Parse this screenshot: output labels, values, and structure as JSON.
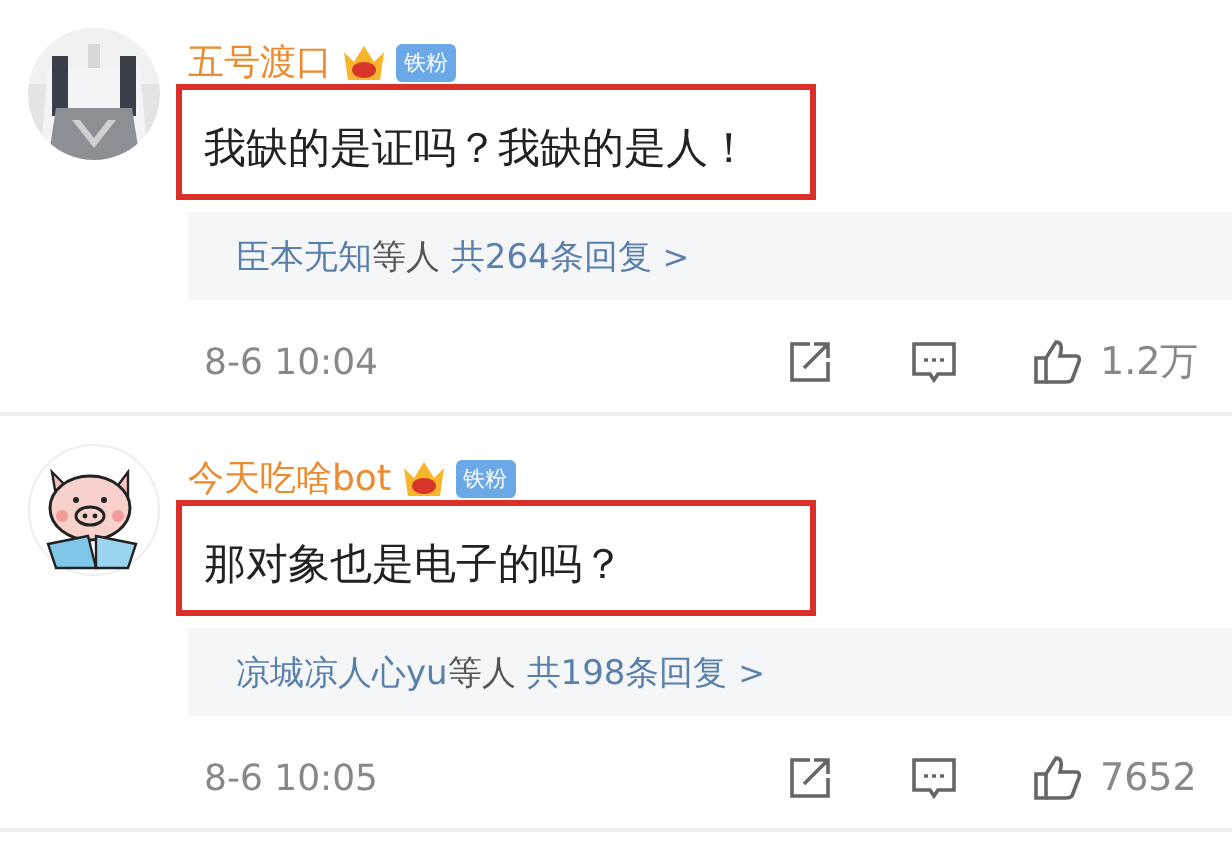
{
  "comments": [
    {
      "name": "五号渡口",
      "badge": "铁粉",
      "text": "我缺的是证吗？我缺的是人！",
      "highlighted": true,
      "replies": {
        "names": "臣本无知",
        "suffix": "等人",
        "count": "共264条回复",
        "arrow": ">"
      },
      "time": "8-6 10:04",
      "likes": "1.2万"
    },
    {
      "avatar": {
        "kind": "pig"
      },
      "name": "今天吃啥bot",
      "badge": "铁粉",
      "text": "那对象也是电子的吗？",
      "highlighted": true,
      "replies": {
        "names": "凉城凉人心yu",
        "suffix": "等人",
        "count": "共198条回复",
        "arrow": ">"
      },
      "time": "8-6 10:05",
      "likes": "7652"
    }
  ]
}
